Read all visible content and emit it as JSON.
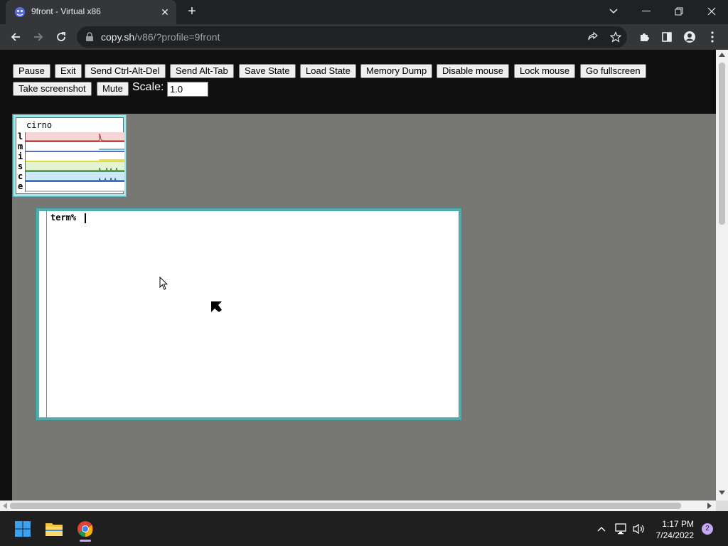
{
  "browser": {
    "tab_title": "9front - Virtual x86",
    "tab_close_glyph": "✕",
    "newtab_glyph": "+",
    "url_host": "copy.sh",
    "url_path": "/v86/?profile=9front"
  },
  "controls": {
    "buttons": {
      "pause": "Pause",
      "exit": "Exit",
      "ctrl_alt_del": "Send Ctrl-Alt-Del",
      "alt_tab": "Send Alt-Tab",
      "save_state": "Save State",
      "load_state": "Load State",
      "memory_dump": "Memory Dump",
      "disable_mouse": "Disable mouse",
      "lock_mouse": "Lock mouse",
      "fullscreen": "Go fullscreen",
      "screenshot": "Take screenshot",
      "mute": "Mute"
    },
    "scale_label": "Scale:",
    "scale_value": "1.0"
  },
  "vm": {
    "stats": {
      "title": "cirno",
      "rows": [
        {
          "letter": "l",
          "bg": "#f4d6d6",
          "line": "#b03030"
        },
        {
          "letter": "m",
          "bg": "#ffffff",
          "line": "#2040a0"
        },
        {
          "letter": "i",
          "bg": "#ffffff",
          "line": "#c0b000"
        },
        {
          "letter": "s",
          "bg": "#e4f4d0",
          "line": "#308030"
        },
        {
          "letter": "c",
          "bg": "#cfe8f8",
          "line": "#2050a0"
        },
        {
          "letter": "e",
          "bg": "#ffffff",
          "line": "#888888"
        }
      ]
    },
    "terminal": {
      "prompt": "term% "
    }
  },
  "taskbar": {
    "time": "1:17 PM",
    "date": "7/24/2022",
    "notifications": "2"
  }
}
